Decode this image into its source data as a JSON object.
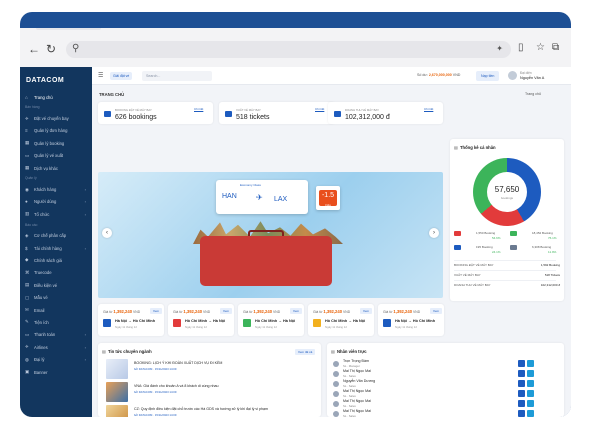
{
  "brand": {
    "logo": "DATACOM"
  },
  "header": {
    "store_label": "Giải đặt vé",
    "search_placeholder": "Search...",
    "balance_label": "Số dư",
    "balance_value": "2,670,000,000",
    "balance_unit": "VND",
    "recharge_label": "Nạp tiền",
    "user_role": "Đại diện",
    "user_name": "Nguyễn Văn A"
  },
  "breadcrumb": {
    "left": "TRANG CHỦ",
    "right": "Trang chủ"
  },
  "sidebar": {
    "items": [
      {
        "label": "Trang chủ",
        "icon": "home-icon"
      },
      {
        "section": "Bán hàng"
      },
      {
        "label": "Đặt vé chuyến bay",
        "icon": "plane-icon"
      },
      {
        "label": "Quản lý đơn hàng",
        "icon": "list-icon"
      },
      {
        "label": "Quản lý booking",
        "icon": "calendar-icon"
      },
      {
        "label": "Quản lý vé xuất",
        "icon": "ticket-icon"
      },
      {
        "label": "Dịch vụ khác",
        "icon": "grid-icon"
      },
      {
        "section": "Quản lý"
      },
      {
        "label": "Khách hàng",
        "icon": "users-icon"
      },
      {
        "label": "Người dùng",
        "icon": "user-icon"
      },
      {
        "label": "Tổ chức",
        "icon": "building-icon"
      },
      {
        "section": "Báo cáo"
      },
      {
        "label": "Cơ chế phân cấp",
        "icon": "layers-icon"
      },
      {
        "label": "Tài chính hàng",
        "icon": "finance-icon"
      },
      {
        "label": "Chính sách giá",
        "icon": "tag-icon"
      },
      {
        "label": "Truecode",
        "icon": "code-icon"
      },
      {
        "label": "Điều kiện vé",
        "icon": "doc-icon"
      },
      {
        "label": "Mẫu vé",
        "icon": "file-icon"
      },
      {
        "label": "Email",
        "icon": "mail-icon"
      },
      {
        "label": "Tiện ích",
        "icon": "tool-icon"
      },
      {
        "label": "Thanh toán",
        "icon": "card-icon"
      },
      {
        "label": "Airlines",
        "icon": "airline-icon"
      },
      {
        "label": "Đại lý",
        "icon": "agency-icon"
      },
      {
        "label": "Banner",
        "icon": "image-icon"
      }
    ]
  },
  "stats": [
    {
      "label": "BOOKING ĐẶT VÉ MÁY BAY",
      "value": "626 bookings",
      "link": "Chi tiết"
    },
    {
      "label": "XUẤT VÉ MÁY BAY",
      "value": "518 tickets",
      "link": "Chi tiết"
    },
    {
      "label": "DOANH THU VÉ MÁY BAY",
      "value": "102,312,000 đ",
      "link": "Chi tiết"
    }
  ],
  "banner": {
    "class_label": "Economy Class",
    "from": "HAN",
    "to": "LAX",
    "promo": "-1.5",
    "promo_sub": "triệu"
  },
  "promos": [
    {
      "from_label": "Giá từ",
      "price": "1,392,240",
      "unit": "VND",
      "route": "Hà Nội → Hồ Chí Minh",
      "date": "Ngày 11 tháng 12",
      "button": "Xem",
      "airline_color": "#1d5bbf"
    },
    {
      "from_label": "Giá từ",
      "price": "1,392,240",
      "unit": "VND",
      "route": "Hồ Chí Minh → Hà Nội",
      "date": "Ngày 11 tháng 12",
      "button": "Xem",
      "airline_color": "#e23b3b"
    },
    {
      "from_label": "Giá từ",
      "price": "1,392,240",
      "unit": "VND",
      "route": "Hồ Chí Minh → Hà Nội",
      "date": "Ngày 11 tháng 12",
      "button": "Xem",
      "airline_color": "#3cb45a"
    },
    {
      "from_label": "Giá từ",
      "price": "1,392,240",
      "unit": "VND",
      "route": "Hồ Chí Minh → Hà Nội",
      "date": "Ngày 11 tháng 12",
      "button": "Xem",
      "airline_color": "#f2b01e"
    },
    {
      "from_label": "Giá từ",
      "price": "1,392,240",
      "unit": "VND",
      "route": "Hà Nội → Hồ Chí Minh",
      "date": "Ngày 11 tháng 12",
      "button": "Xem",
      "airline_color": "#1d5bbf"
    }
  ],
  "summary": {
    "title": "Thống kê cá nhân",
    "total": "57,650",
    "total_label": "bookings",
    "rows": [
      {
        "tag_color": "#e23b3b",
        "label": "1,550 Booking",
        "pct": "54.6%"
      },
      {
        "tag_color": "#3cb45a",
        "label": "18,452 Booking",
        "pct": "76.1%"
      },
      {
        "tag_color": "#1d5bbf",
        "label": "195 Booking",
        "pct": "24.1%"
      },
      {
        "tag_color": "#6b7a90",
        "label": "6,308 Booking",
        "pct": "11.9%"
      }
    ],
    "totals": [
      {
        "label": "BOOKING ĐẶT VÉ MÁY BAY",
        "value": "1,592 Booking"
      },
      {
        "label": "XUẤT VÉ MÁY BAY",
        "value": "518 Tickets"
      },
      {
        "label": "DOANH THU VÉ MÁY BAY",
        "value": "102,312,000 đ"
      }
    ]
  },
  "news": {
    "title": "Tin tức chuyên ngành",
    "button": "Xem tất cả",
    "items": [
      {
        "title": "BOOKING: LỊCH Ý KHI ĐOÀN XUẤT DỊCH VỤ ĐI KÈM",
        "meta": "bởi DATACOM · 15/11/2023 14:09"
      },
      {
        "title": "VNA: Giá đánh cho khoản A và 8 khách di cùng nhau",
        "meta": "bởi DATACOM · 15/11/2023 14:09"
      },
      {
        "title": "CZ: Quy định điều kiện đặt chỗ trước các Hà GDS và hướng xử lý khi đại lý vi phạm",
        "meta": "bởi DATACOM · 15/11/2023 14:09"
      }
    ]
  },
  "staff": {
    "title": "Nhân viên trực",
    "items": [
      {
        "name": "Trọn Trọng Đàm",
        "role": "SL · Manager"
      },
      {
        "name": "Mai Thị Ngọc Mai",
        "role": "SL · Sales"
      },
      {
        "name": "Nguyễn Văn Dương",
        "role": "SL · Sales"
      },
      {
        "name": "Mai Thị Ngọc Mai",
        "role": "SL · Sales"
      },
      {
        "name": "Mai Thị Ngọc Mai",
        "role": "SL · Sales"
      },
      {
        "name": "Mai Thị Ngọc Mai",
        "role": "SL · Sales"
      }
    ]
  }
}
